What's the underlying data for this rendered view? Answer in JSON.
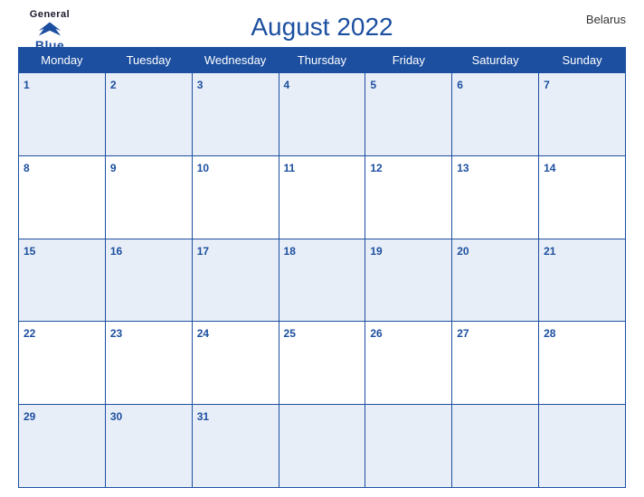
{
  "logo": {
    "general": "General",
    "blue": "Blue"
  },
  "country": "Belarus",
  "title": "August 2022",
  "weekdays": [
    "Monday",
    "Tuesday",
    "Wednesday",
    "Thursday",
    "Friday",
    "Saturday",
    "Sunday"
  ],
  "weeks": [
    [
      1,
      2,
      3,
      4,
      5,
      6,
      7
    ],
    [
      8,
      9,
      10,
      11,
      12,
      13,
      14
    ],
    [
      15,
      16,
      17,
      18,
      19,
      20,
      21
    ],
    [
      22,
      23,
      24,
      25,
      26,
      27,
      28
    ],
    [
      29,
      30,
      31,
      null,
      null,
      null,
      null
    ]
  ],
  "colors": {
    "primary": "#1c4fa0",
    "header_bg": "#1c4fa0",
    "row_shade": "#e8eef7"
  }
}
